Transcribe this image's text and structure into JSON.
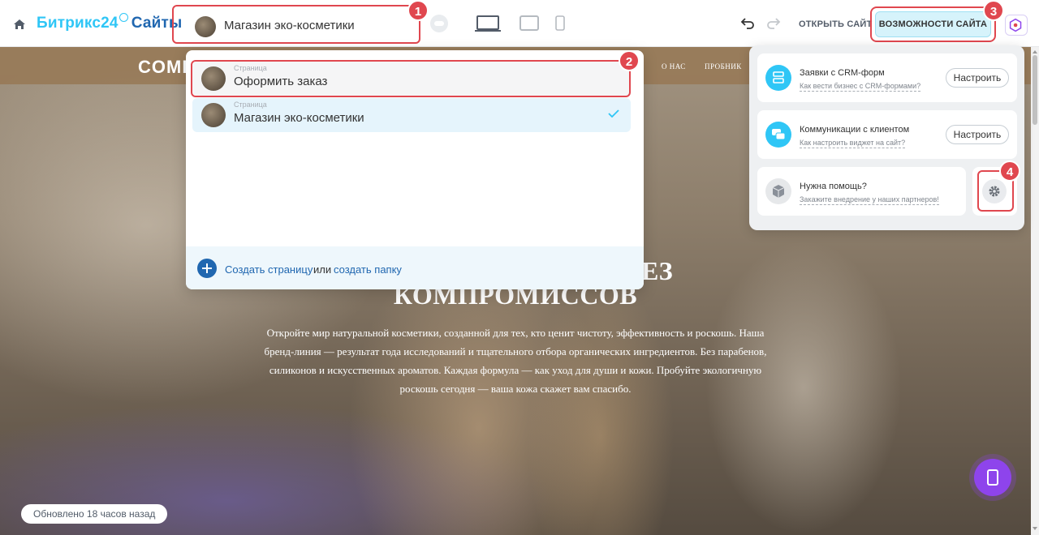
{
  "topbar": {
    "logo_b24": "Битрикс24",
    "logo_sites": "Сайты",
    "site_name": "Магазин эко-косметики",
    "open_site": "ОТКРЫТЬ САЙТ",
    "features": "ВОЗМОЖНОСТИ САЙТА"
  },
  "hero": {
    "brand": "COMP",
    "nav": [
      "О НАС",
      "ПРОБНИК"
    ],
    "title_tail": "ЕЗ",
    "title_line2": "КОМПРОМИССОВ",
    "text": "Откройте мир натуральной косметики, созданной для тех, кто ценит чистоту, эффективность и роскошь. Наша бренд-линия — результат года исследований и тщательного отбора органических ингредиентов. Без парабенов, силиконов и искусственных ароматов. Каждая формула — как уход для души и кожи. Пробуйте экологичную роскошь сегодня — ваша кожа скажет вам спасибо."
  },
  "updated": "Обновлено 18 часов назад",
  "pages_popup": {
    "items": [
      {
        "kind": "Страница",
        "title": "Оформить заказ"
      },
      {
        "kind": "Страница",
        "title": "Магазин эко-косметики"
      }
    ],
    "create_page": "Создать страницу",
    "or": "или",
    "create_folder": "создать папку"
  },
  "features_panel": {
    "cards": [
      {
        "title": "Заявки с CRM-форм",
        "subtitle": "Как вести бизнес с CRM-формами?",
        "button": "Настроить"
      },
      {
        "title": "Коммуникации с клиентом",
        "subtitle": "Как настроить виджет на сайт?",
        "button": "Настроить"
      },
      {
        "title": "Нужна помощь?",
        "subtitle": "Закажите внедрение у наших партнеров!"
      }
    ]
  },
  "markers": [
    "1",
    "2",
    "3",
    "4"
  ],
  "colors": {
    "accent": "#2fc6f6",
    "brand": "#2067b0",
    "highlight": "#e0474f",
    "purple": "#8e44ec"
  },
  "icons": [
    "home-icon",
    "cloud-icon",
    "desktop-icon",
    "tablet-icon",
    "mobile-icon",
    "undo-icon",
    "redo-icon",
    "ai-icon",
    "check-icon",
    "plus-icon",
    "crm-form-icon",
    "chat-icon",
    "box-icon",
    "gear-icon",
    "phone-icon"
  ]
}
